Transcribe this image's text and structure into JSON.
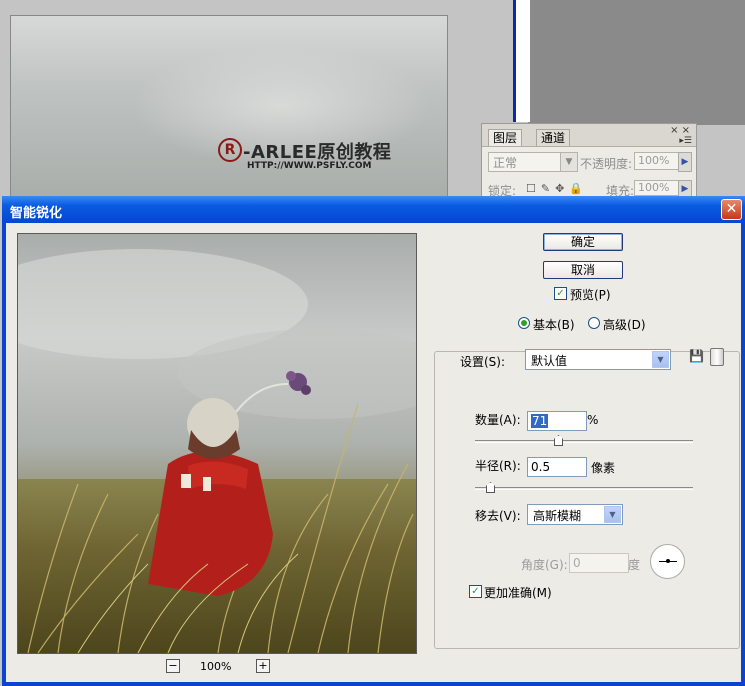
{
  "background": {
    "logo_text": "-ARLEE原创教程",
    "logo_url": "HTTP://WWW.PSFLY.COM"
  },
  "layers_panel": {
    "tabs": [
      "图层",
      "通道"
    ],
    "close_glyph": "× ×",
    "blend_mode": "正常",
    "opacity_label": "不透明度:",
    "opacity_value": "100%",
    "lock_label": "锁定:",
    "fill_label": "填充:",
    "fill_value": "100%"
  },
  "dialog": {
    "title": "智能锐化",
    "ok_label": "确定",
    "cancel_label": "取消",
    "preview_label": "预览(P)",
    "preview_checked": true,
    "mode": {
      "basic_label": "基本(B)",
      "advanced_label": "高级(D)",
      "selected": "basic"
    },
    "settings_label": "设置(S):",
    "settings_value": "默认值",
    "amount_label": "数量(A):",
    "amount_value": "71",
    "amount_unit": "%",
    "radius_label": "半径(R):",
    "radius_value": "0.5",
    "radius_unit": "像素",
    "remove_label": "移去(V):",
    "remove_value": "高斯模糊",
    "angle_label": "角度(G):",
    "angle_value": "0",
    "angle_unit": "度",
    "more_accurate_label": "更加准确(M)",
    "more_accurate_checked": true,
    "zoom_value": "100%",
    "zoom_out": "−",
    "zoom_in": "+"
  },
  "colors": {
    "titlebar": "#0a5be0",
    "selection": "#316ac5",
    "check_mark": "#21a121"
  }
}
